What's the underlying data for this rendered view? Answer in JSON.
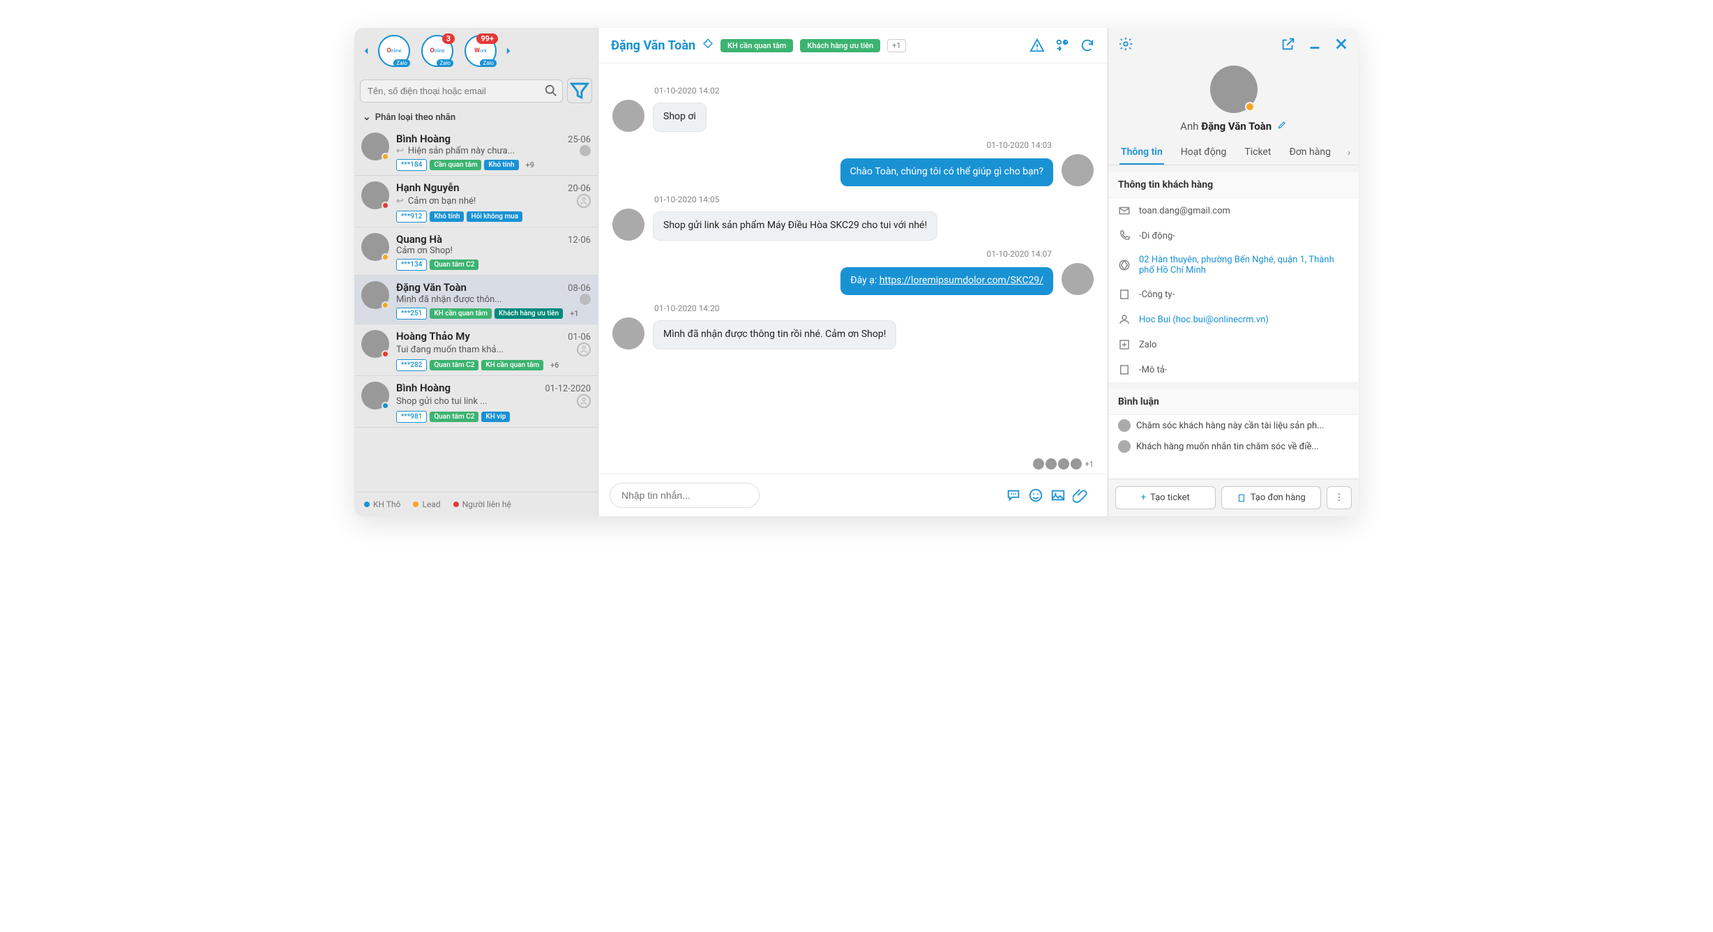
{
  "accounts": {
    "items": [
      {
        "label": "Online CRM",
        "sub": "Zalo",
        "badge": ""
      },
      {
        "label": "Online CRM",
        "sub": "Zalo",
        "badge": "3"
      },
      {
        "label": "Work",
        "sub": "Zalo",
        "badge": "99+"
      }
    ]
  },
  "search": {
    "placeholder": "Tên, số điện thoại hoặc email"
  },
  "classify": {
    "label": "Phân loại theo nhãn"
  },
  "conversations": [
    {
      "name": "Bình Hoàng",
      "time": "25-06",
      "msg": "Hiện sản phẩm này chưa...",
      "code": "***184",
      "dot": "#f5a623",
      "showReply": true,
      "showMini": true,
      "tags": [
        {
          "t": "Cần quan tâm",
          "c": "green"
        },
        {
          "t": "Khó tính",
          "c": "blue"
        }
      ],
      "plus": "+9"
    },
    {
      "name": "Hạnh Nguyễn",
      "time": "20-06",
      "msg": "Cảm ơn bạn nhé!",
      "code": "***912",
      "dot": "#e53935",
      "showReply": true,
      "showAssign": true,
      "tags": [
        {
          "t": "Khó tính",
          "c": "blue"
        },
        {
          "t": "Hỏi không mua",
          "c": "blue"
        }
      ],
      "plus": ""
    },
    {
      "name": "Quang Hà",
      "time": "12-06",
      "msg": "Cảm ơn Shop!",
      "code": "***134",
      "dot": "#f5a623",
      "tags": [
        {
          "t": "Quan tâm C2",
          "c": "green"
        }
      ],
      "plus": ""
    },
    {
      "name": "Đặng Văn Toàn",
      "time": "08-06",
      "msg": "Mình đã nhận được thôn...",
      "code": "***251",
      "dot": "#f5a623",
      "showMini": true,
      "selected": true,
      "tags": [
        {
          "t": "KH cần quan tâm",
          "c": "green"
        },
        {
          "t": "Khách hàng ưu tiên",
          "c": "teal"
        }
      ],
      "plus": "+1"
    },
    {
      "name": "Hoàng Thảo My",
      "time": "01-06",
      "msg": "Tui đang muốn tham khả...",
      "code": "***282",
      "dot": "#e53935",
      "showAssign": true,
      "tags": [
        {
          "t": "Quan tâm C2",
          "c": "green"
        },
        {
          "t": "KH cần quan tâm",
          "c": "green"
        }
      ],
      "plus": "+6"
    },
    {
      "name": "Bình Hoàng",
      "time": "01-12-2020",
      "msg": "Shop gửi cho tui link ...",
      "code": "***981",
      "dot": "#1992d4",
      "showAssign": true,
      "tags": [
        {
          "t": "Quan tâm C2",
          "c": "green"
        },
        {
          "t": "KH vip",
          "c": "blue"
        }
      ],
      "plus": ""
    }
  ],
  "legend": [
    {
      "label": "KH Thô",
      "color": "#1992d4"
    },
    {
      "label": "Lead",
      "color": "#f5a623"
    },
    {
      "label": "Người liên hệ",
      "color": "#e53935"
    }
  ],
  "chat": {
    "name": "Đặng Văn Toàn",
    "pills": [
      "KH cần quan tâm",
      "Khách hàng ưu tiên"
    ],
    "plus": "+1",
    "messages": [
      {
        "ts": "01-10-2020 14:02",
        "dir": "in",
        "text": "Shop ơi"
      },
      {
        "ts": "01-10-2020 14:03",
        "dir": "out",
        "text": "Chào Toàn, chúng tôi có thể giúp gì cho bạn?"
      },
      {
        "ts": "01-10-2020 14:05",
        "dir": "in",
        "text": "Shop gửi link sản phẩm Máy Điều Hòa SKC29 cho tui với nhé!"
      },
      {
        "ts": "01-10-2020 14:07",
        "dir": "out",
        "prefix": "Đây ạ: ",
        "link": "https://loremipsumdolor.com/SKC29/"
      },
      {
        "ts": "01-10-2020 14:20",
        "dir": "in",
        "text": "Mình đã nhận được thông tin rồi nhé. Cảm ơn Shop!"
      }
    ],
    "seen_plus": "+1",
    "input_placeholder": "Nhập tin nhắn..."
  },
  "panel": {
    "prefix": "Anh",
    "name": "Đặng Văn Toàn",
    "tabs": [
      "Thông tin",
      "Hoạt động",
      "Ticket",
      "Đơn hàng"
    ],
    "info_title": "Thông tin khách hàng",
    "email": "toan.dang@gmail.com",
    "phone": "-Di động-",
    "address": "02 Hàn thuyên, phường Bến Nghé, quận 1, Thành phố Hồ Chí Minh",
    "company": "-Công ty-",
    "owner": "Hoc Bui (hoc.bui@onlinecrm.vn)",
    "source": "Zalo",
    "desc": "-Mô tả-",
    "comments_title": "Bình luận",
    "comments": [
      "Chăm sóc khách hàng này cần tài liệu sản ph...",
      "Khách hàng muốn nhắn tin chăm sóc về điề..."
    ],
    "btn_ticket": "Tạo ticket",
    "btn_order": "Tạo đơn hàng"
  }
}
